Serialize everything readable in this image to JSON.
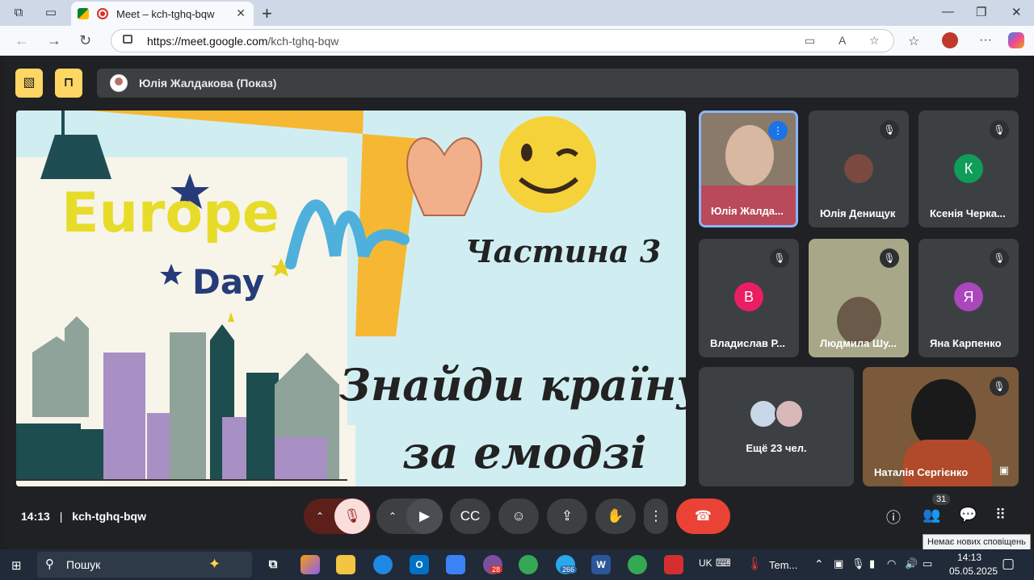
{
  "browser": {
    "tab_title": "Meet – kch-tghq-bqw",
    "url_host": "https://meet.google.com",
    "url_path": "/kch-tghq-bqw"
  },
  "meet": {
    "presenter_label": "Юлія Жалдакова (Показ)",
    "time": "14:13",
    "separator": "|",
    "meeting_code": "kch-tghq-bqw",
    "participants_count": "31",
    "notification_text": "Немає нових сповіщень",
    "tiles": [
      {
        "name": "Юлія Жалда...",
        "avatar_letter": "",
        "color": "#8a7a6a"
      },
      {
        "name": "Юлія Денищук",
        "avatar_letter": "",
        "color": "#7a4a40"
      },
      {
        "name": "Ксенія Черка...",
        "avatar_letter": "К",
        "color": "#0f9d58"
      },
      {
        "name": "Владислав Р...",
        "avatar_letter": "В",
        "color": "#e91e63"
      },
      {
        "name": "Людмила Шу...",
        "avatar_letter": "",
        "color": "#a8a888"
      },
      {
        "name": "Яна Карпенко",
        "avatar_letter": "Я",
        "color": "#ab47bc"
      },
      {
        "name": "Ещё 23 чел.",
        "avatar_letter": "",
        "color": "#3c4043"
      },
      {
        "name": "Наталія Сергієнко",
        "avatar_letter": "",
        "color": "#7a5a3a"
      }
    ]
  },
  "slide": {
    "europe": "Europe",
    "day": "Day",
    "part": "Частина 3",
    "line1": "Знайди країну",
    "line2": "за емодзі"
  },
  "taskbar": {
    "search_label": "Пошук",
    "lang": "UK",
    "weather": "Tem...",
    "clock_time": "14:13",
    "clock_date": "05.05.2025",
    "badge_viber": "28",
    "badge_telegram": "266"
  },
  "colors": {
    "accent_yellow": "#fdd663",
    "end_call": "#ea4335",
    "mic_off": "#f9dedc"
  }
}
